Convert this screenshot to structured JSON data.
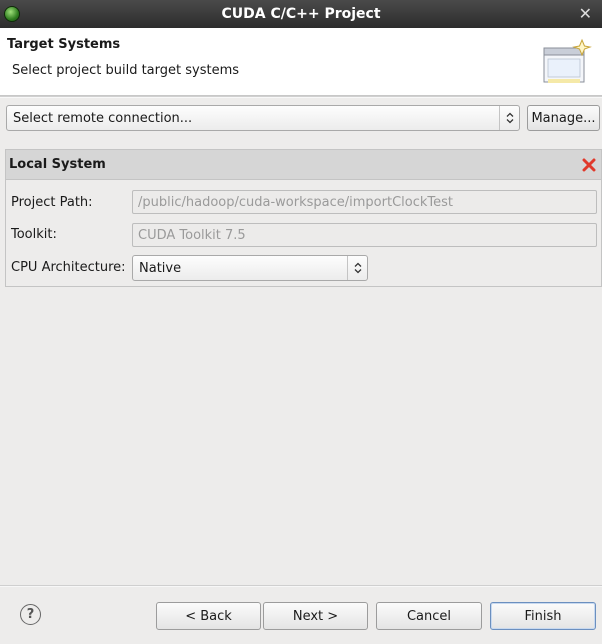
{
  "window": {
    "title": "CUDA C/C++ Project",
    "close_glyph": "✕"
  },
  "header": {
    "title": "Target Systems",
    "subtitle": "Select project build target systems"
  },
  "remote": {
    "selected": "Select remote connection...",
    "manage_label": "Manage..."
  },
  "local_system": {
    "title": "Local System",
    "project_path_label": "Project Path:",
    "project_path_value": "/public/hadoop/cuda-workspace/importClockTest",
    "toolkit_label": "Toolkit:",
    "toolkit_value": "CUDA Toolkit 7.5",
    "cpu_arch_label": "CPU Architecture:",
    "cpu_arch_value": "Native"
  },
  "footer": {
    "help_glyph": "?",
    "back_label": "< Back",
    "next_label": "Next >",
    "cancel_label": "Cancel",
    "finish_label": "Finish"
  },
  "colors": {
    "remove_icon": "#e0392b",
    "titlebar": "#2c2c2c",
    "disabled_text": "#9a9a9a"
  }
}
